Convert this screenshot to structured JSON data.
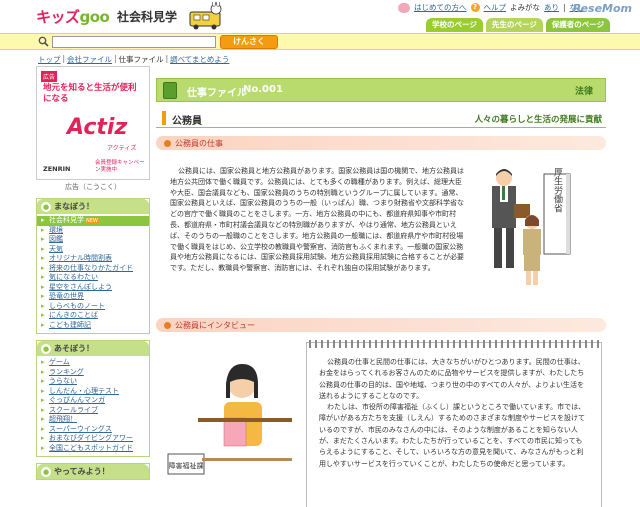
{
  "header": {
    "logo_kids": "キッズ",
    "logo_goo": "goo",
    "site_title": "社会科見学",
    "links": [
      "はじめての方へ",
      "ヘルプ",
      "よみがな"
    ],
    "yomigana_options": [
      "あり",
      "なし"
    ],
    "audience_tabs": [
      "学校のページ",
      "先生のページ",
      "保護者のページ"
    ],
    "watermark": "ReseMom"
  },
  "search": {
    "value": "",
    "button_label": "けんさく"
  },
  "breadcrumb": {
    "items": [
      "トップ",
      "会社ファイル",
      "仕事ファイル",
      "調べてまとめよう"
    ],
    "current_index": 2
  },
  "sidebar": {
    "ad": {
      "tag": "広告",
      "heading": "地元を知ると生活が便利になる",
      "brand": "Actiz",
      "brand_sub": "アクティズ",
      "maker": "ZENRIN",
      "promo": "会員登録キャンペーン実施中",
      "caption": "広告（こうこく）"
    },
    "sections": [
      {
        "title": "まなぼう！",
        "items": [
          "社会科見学",
          "環境",
          "図鑑",
          "天気",
          "オリジナル時間割表",
          "将来の仕事なりかたガイド",
          "気になるわたい",
          "星空をさんぽしよう",
          "恐竜の世界",
          "しらべものノート",
          "にんきのことば",
          "こども建師記"
        ],
        "active_index": 0,
        "new_index": 0,
        "new_label": "NEW"
      },
      {
        "title": "あそぼう！",
        "items": [
          "ゲーム",
          "ランキング",
          "うらない",
          "しんだん・心理テスト",
          "ぐっぴんんマンガ",
          "スクールライブ",
          "超飛翔！",
          "スーパーウイングス",
          "おまなびダイビングアワー",
          "全国こどもスポットガイド"
        ]
      },
      {
        "title": "やってみよう！",
        "items": []
      }
    ]
  },
  "main": {
    "file_label": "仕事ファイル",
    "file_number": "No.001",
    "category": "法律",
    "job_name": "公務員",
    "tagline": "人々の暮らしと生活の発展に貢献",
    "section1_title": "公務員の仕事",
    "section1_body": "公務員には、国家公務員と地方公務員があります。国家公務員は国の機関で、地方公務員は地方公共団体で働く職員です。公務員には、とても多くの職種があります。例えば、総理大臣や大臣、国会議員なども、国家公務員のうちの特別職というグループに属しています。通常、国家公務員といえば、国家公務員のうちの一般（いっぱん）職、つまり財務省や文部科学省などの官庁で働く職員のことをさします。一方、地方公務員の中にも、都道府県知事や市町村長、都道府県・市町村議会議員などの特別職がありますが、やはり通常、地方公務員といえば、そのうちの一般職のことをさします。地方公務員の一般職には、都道府県庁や市町村役場で働く職員をはじめ、公立学校の教職員や警察官、消防官もふくまれます。一般職の国家公務員や地方公務員になるには、国家公務員採用試験、地方公務員採用試験に合格することが必要です。ただし、教職員や警察官、消防官には、それぞれ独自の採用試験があります。",
    "office_sign": "厚生労働省",
    "section2_title": "公務員にインタビュー",
    "interview_sign": "障害福祉課",
    "interview_p1": "公務員の仕事と民間の仕事には、大きなちがいがひとつあります。民間の仕事は、お金をはらってくれるお客さんのために品物やサービスを提供しますが、わたしたち公務員の仕事の目的は、国や地域、つまり世の中のすべての人々が、よりよい生活を送れるようにすることなのです。",
    "interview_p2": "わたしは、市役所の障害福祉（ふくし）課というところで働いています。市では、障がいがある方たちを支援（しえん）するためのさまざまな制度やサービスを設けているのですが、市民のみなさんの中には、そのような制度があることを知らない人が、まだたくさんいます。わたしたちが行っていることを、すべての市民に知ってもらえるようにすること、そして、いろいろな方の意見を聞いて、みなさんがもっと利用しやすいサービスを行っていくことが、わたしたちの使命だと思っています。"
  },
  "colors": {
    "brand_pink": "#e0245a",
    "brand_green": "#8cc63f",
    "search_bg": "#fff9b0",
    "button_orange": "#f39c12",
    "section_pink": "#fbd3c1",
    "link_blue": "#336699"
  }
}
